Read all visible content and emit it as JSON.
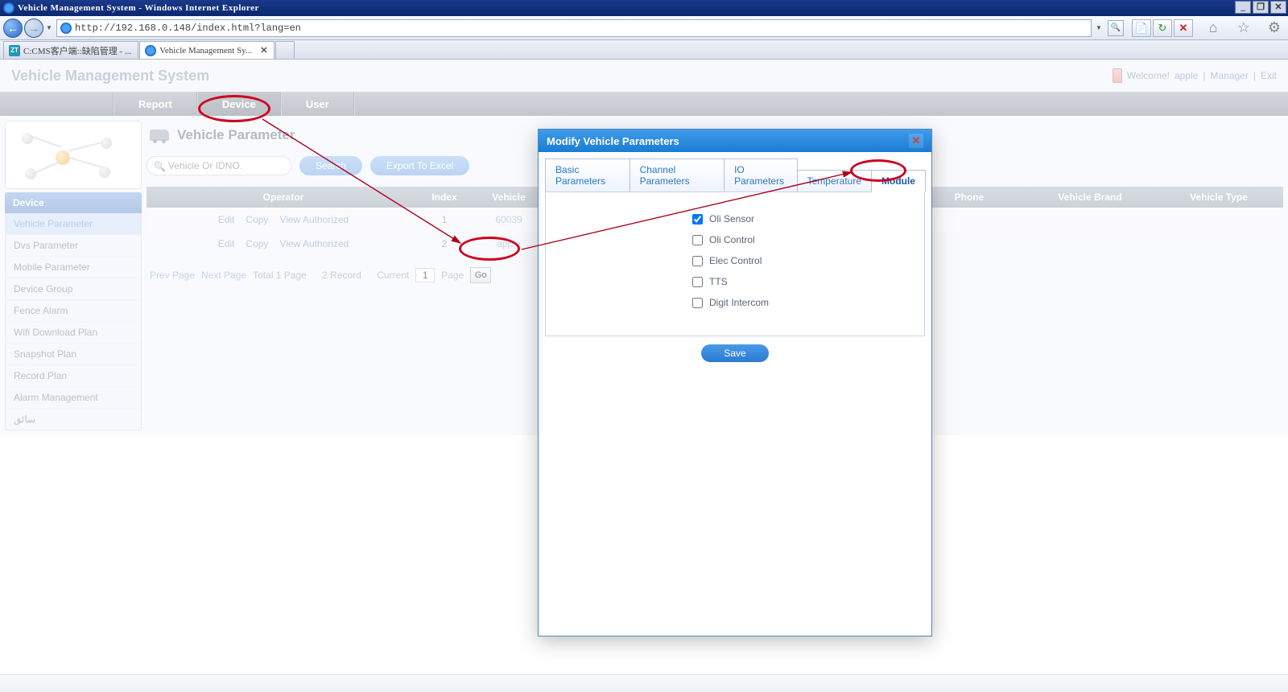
{
  "ie": {
    "title": "Vehicle Management System - Windows Internet Explorer",
    "url": "http://192.168.0.148/index.html?lang=en",
    "tabs": [
      {
        "label": "C:CMS客户端::缺陷管理 - ...",
        "icon": "ZT"
      },
      {
        "label": "Vehicle Management Sy...",
        "icon": "e",
        "active": true
      }
    ],
    "winbtns": {
      "min": "_",
      "restore": "❐",
      "close": "✕"
    }
  },
  "header": {
    "app_title": "Vehicle Management System",
    "welcome": "Welcome!",
    "user": "apple",
    "manager": "Manager",
    "exit": "Exit"
  },
  "nav": {
    "items": [
      "Report",
      "Device",
      "User"
    ],
    "active": 1
  },
  "sidebar": {
    "title": "Device",
    "items": [
      "Vehicle Parameter",
      "Dvs Parameter",
      "Mobile Parameter",
      "Device Group",
      "Fence Alarm",
      "Wifi Download Plan",
      "Snapshot Plan",
      "Record Plan",
      "Alarm Management",
      "سائق"
    ],
    "active": 0
  },
  "content": {
    "page_title": "Vehicle Parameter",
    "search_placeholder": "Vehicle Or IDNO.",
    "search_btn": "Search",
    "export_btn": "Export To Excel",
    "table": {
      "headers": {
        "operator": "Operator",
        "index": "Index",
        "vehicle": "Vehicle",
        "phone": "Phone",
        "brand": "Vehicle Brand",
        "type": "Vehicle Type"
      },
      "row_actions": {
        "edit": "Edit",
        "copy": "Copy",
        "view": "View Authorized"
      },
      "rows": [
        {
          "index": "1",
          "vehicle": "60039"
        },
        {
          "index": "2",
          "vehicle": "apple"
        }
      ]
    },
    "pager": {
      "prev": "Prev Page",
      "next": "Next Page",
      "total": "Total 1 Page",
      "record": "2 Record",
      "current_label": "Current",
      "current_value": "1",
      "page_label": "Page",
      "go": "Go"
    }
  },
  "modal": {
    "title": "Modify Vehicle Parameters",
    "tabs": [
      "Basic Parameters",
      "Channel Parameters",
      "IO Parameters",
      "Temperature",
      "Module"
    ],
    "active_tab": 4,
    "module": {
      "options": [
        {
          "label": "Oli Sensor",
          "checked": true
        },
        {
          "label": "Oli Control",
          "checked": false
        },
        {
          "label": "Elec Control",
          "checked": false
        },
        {
          "label": "TTS",
          "checked": false
        },
        {
          "label": "Digit Intercom",
          "checked": false
        }
      ]
    },
    "save": "Save"
  }
}
